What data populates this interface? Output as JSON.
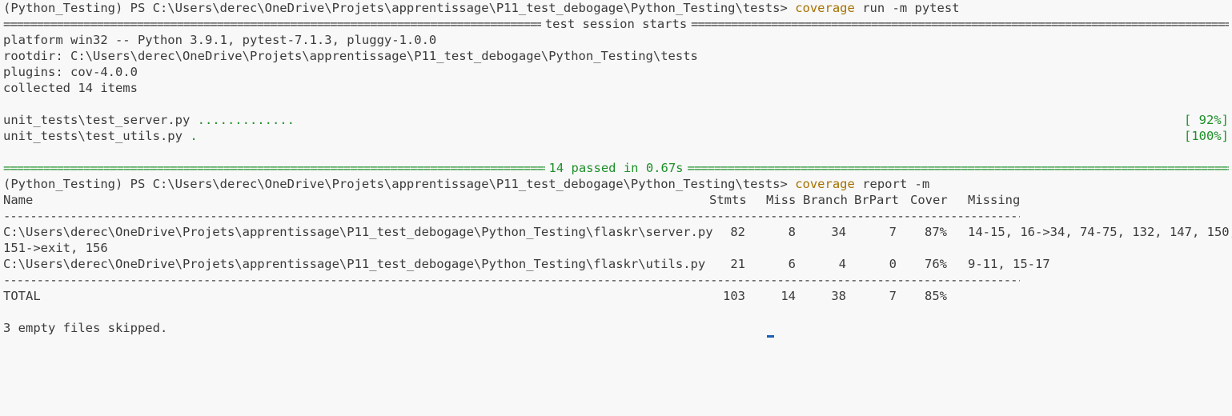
{
  "commands": [
    {
      "prompt": "(Python_Testing) PS C:\\Users\\derec\\OneDrive\\Projets\\apprentissage\\P11_test_debogage\\Python_Testing\\tests>",
      "command": "coverage",
      "args": "run -m pytest"
    },
    {
      "prompt": "(Python_Testing) PS C:\\Users\\derec\\OneDrive\\Projets\\apprentissage\\P11_test_debogage\\Python_Testing\\tests>",
      "command": "coverage",
      "args": "report -m"
    }
  ],
  "session": {
    "header_title": "test session starts",
    "platform": "platform win32 -- Python 3.9.1, pytest-7.1.3, pluggy-1.0.0",
    "rootdir": "rootdir: C:\\Users\\derec\\OneDrive\\Projets\\apprentissage\\P11_test_debogage\\Python_Testing\\tests",
    "plugins": "plugins: cov-4.0.0",
    "collected": "collected 14 items",
    "results": [
      {
        "file": "unit_tests\\test_server.py",
        "dots": ".............",
        "percent": "[ 92%]"
      },
      {
        "file": "unit_tests\\test_utils.py",
        "dots": ".",
        "percent": "[100%]"
      }
    ],
    "summary": "14 passed in 0.67s"
  },
  "report": {
    "headers": {
      "name": "Name",
      "stmts": "Stmts",
      "miss": "Miss",
      "branch": "Branch",
      "brpart": "BrPart",
      "cover": "Cover",
      "missing": "Missing"
    },
    "rows": [
      {
        "name": "C:\\Users\\derec\\OneDrive\\Projets\\apprentissage\\P11_test_debogage\\Python_Testing\\flaskr\\server.py",
        "stmts": "82",
        "miss": "8",
        "branch": "34",
        "brpart": "7",
        "cover": "87%",
        "missing": "14-15, 16->34, 74-75, 132, 147, 150,",
        "missing_cont": "151->exit, 156"
      },
      {
        "name": "C:\\Users\\derec\\OneDrive\\Projets\\apprentissage\\P11_test_debogage\\Python_Testing\\flaskr\\utils.py",
        "stmts": "21",
        "miss": "6",
        "branch": "4",
        "brpart": "0",
        "cover": "76%",
        "missing": "9-11, 15-17"
      }
    ],
    "total": {
      "name": "TOTAL",
      "stmts": "103",
      "miss": "14",
      "branch": "38",
      "brpart": "7",
      "cover": "85%"
    },
    "skipped": "3 empty files skipped."
  },
  "colors": {
    "background": "#f8f8f8",
    "text": "#3b3b3b",
    "command": "#a67100",
    "pass": "#1f8f2a",
    "cursor": "#1a5fb4"
  }
}
